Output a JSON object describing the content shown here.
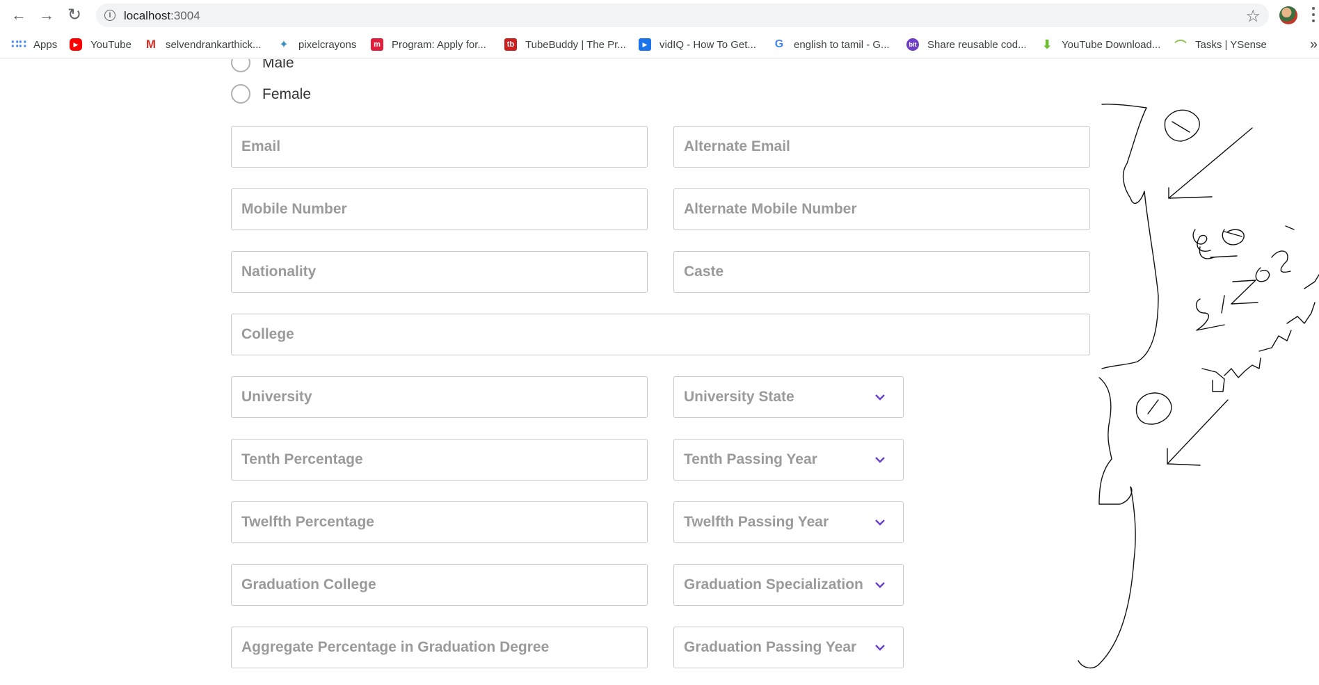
{
  "browser": {
    "url_host": "localhost",
    "url_port": ":3004",
    "bookmarks": [
      {
        "label": "Apps",
        "icon": "apps-grid-icon",
        "color": "#4285f4"
      },
      {
        "label": "YouTube",
        "icon": "youtube-icon",
        "color": "#ff0000"
      },
      {
        "label": "selvendrankarthick...",
        "icon": "gmail-icon",
        "color": "#d93025"
      },
      {
        "label": "pixelcrayons",
        "icon": "pixelcrayons-icon",
        "color": "#3c8dbc"
      },
      {
        "label": "Program: Apply for...",
        "icon": "m-icon",
        "color": "#e01f3d"
      },
      {
        "label": "TubeBuddy | The Pr...",
        "icon": "tubebuddy-icon",
        "color": "#cc1f1f"
      },
      {
        "label": "vidIQ - How To Get...",
        "icon": "vidiq-icon",
        "color": "#1a73e8"
      },
      {
        "label": "english to tamil - G...",
        "icon": "google-icon",
        "color": "#4285f4"
      },
      {
        "label": "Share reusable cod...",
        "icon": "bit-icon",
        "color": "#6c3fc5"
      },
      {
        "label": "YouTube Download...",
        "icon": "download-icon",
        "color": "#6bbf2a"
      },
      {
        "label": "Tasks | YSense",
        "icon": "ysense-icon",
        "color": "#8bc34a"
      }
    ],
    "more_label": "»"
  },
  "form": {
    "gender_options": [
      "Male",
      "Female"
    ],
    "email_placeholder": "Email",
    "alt_email_placeholder": "Alternate Email",
    "mobile_placeholder": "Mobile Number",
    "alt_mobile_placeholder": "Alternate Mobile Number",
    "nationality_placeholder": "Nationality",
    "caste_placeholder": "Caste",
    "college_placeholder": "College",
    "university_placeholder": "University",
    "university_state_placeholder": "University State",
    "tenth_percentage_placeholder": "Tenth Percentage",
    "tenth_year_placeholder": "Tenth Passing Year",
    "twelfth_percentage_placeholder": "Twelfth Percentage",
    "twelfth_year_placeholder": "Twelfth Passing Year",
    "grad_college_placeholder": "Graduation College",
    "grad_spec_placeholder": "Graduation Specialization",
    "aggregate_placeholder": "Aggregate Percentage in Graduation Degree",
    "grad_year_placeholder": "Graduation Passing Year"
  },
  "colors": {
    "accent": "#6a3fc8",
    "border": "#c9c9c9",
    "placeholder": "#9a9a9a"
  }
}
